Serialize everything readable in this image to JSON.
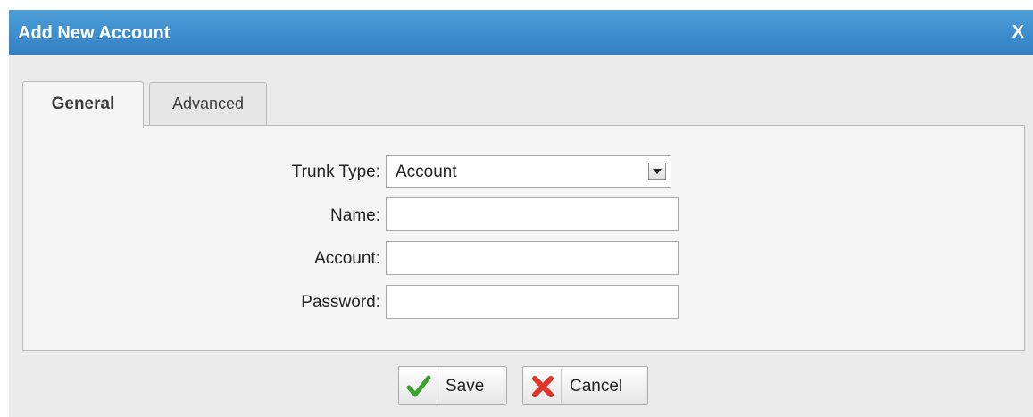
{
  "dialog": {
    "title": "Add New Account",
    "close_label": "X"
  },
  "tabs": [
    {
      "label": "General",
      "active": true
    },
    {
      "label": "Advanced",
      "active": false
    }
  ],
  "form": {
    "trunk_type": {
      "label": "Trunk Type:",
      "value": "Account"
    },
    "name": {
      "label": "Name:",
      "value": ""
    },
    "account": {
      "label": "Account:",
      "value": ""
    },
    "password": {
      "label": "Password:",
      "value": ""
    }
  },
  "buttons": {
    "save": {
      "label": "Save",
      "icon": "check-icon",
      "icon_color": "#3aa02e"
    },
    "cancel": {
      "label": "Cancel",
      "icon": "x-icon",
      "icon_color": "#e0352b"
    }
  },
  "colors": {
    "titlebar": "#3d8dcd",
    "dialog_bg": "#ebebeb",
    "panel_bg": "#f5f5f5"
  }
}
